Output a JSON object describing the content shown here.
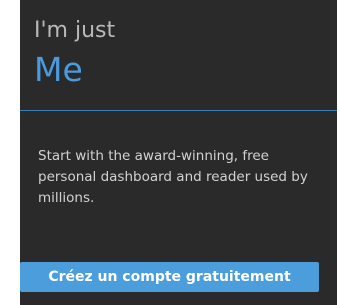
{
  "plan": {
    "subtitle": "I'm just",
    "title": "Me",
    "description": "Start with the award-winning, free personal dashboard and reader used by millions.",
    "cta_label": "Créez un compte gratuitement"
  },
  "colors": {
    "panel_background": "#2a2a2a",
    "title_blue": "#4a9ae0",
    "divider_blue": "#3f7fb8",
    "button_blue": "#4b9edb",
    "button_text": "#ffffff"
  }
}
